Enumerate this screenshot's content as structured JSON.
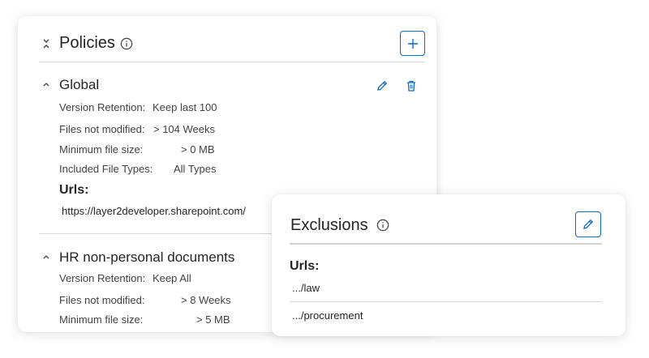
{
  "policies": {
    "title": "Policies",
    "groups": [
      {
        "name": "Global",
        "rows": [
          {
            "label": "Version Retention:",
            "value": "Keep last 100"
          },
          {
            "label": "Files not modified:",
            "value": "> 104 Weeks"
          },
          {
            "label": "Minimum file size:",
            "value": "> 0 MB"
          },
          {
            "label": "Included File Types:",
            "value": "All Types"
          }
        ],
        "urls_label": "Urls:",
        "urls": [
          "https://layer2developer.sharepoint.com/"
        ]
      },
      {
        "name": "HR non-personal documents",
        "rows": [
          {
            "label": "Version Retention:",
            "value": "Keep All"
          },
          {
            "label": "Files not modified:",
            "value": "> 8 Weeks"
          },
          {
            "label": "Minimum file size:",
            "value": "> 5 MB"
          }
        ]
      }
    ]
  },
  "exclusions": {
    "title": "Exclusions",
    "urls_label": "Urls:",
    "urls": [
      ".../law",
      ".../procurement"
    ]
  },
  "colors": {
    "accent": "#0f6cbd",
    "text": "#242424",
    "secondary_text": "#424242",
    "divider": "#d6d6d6"
  }
}
